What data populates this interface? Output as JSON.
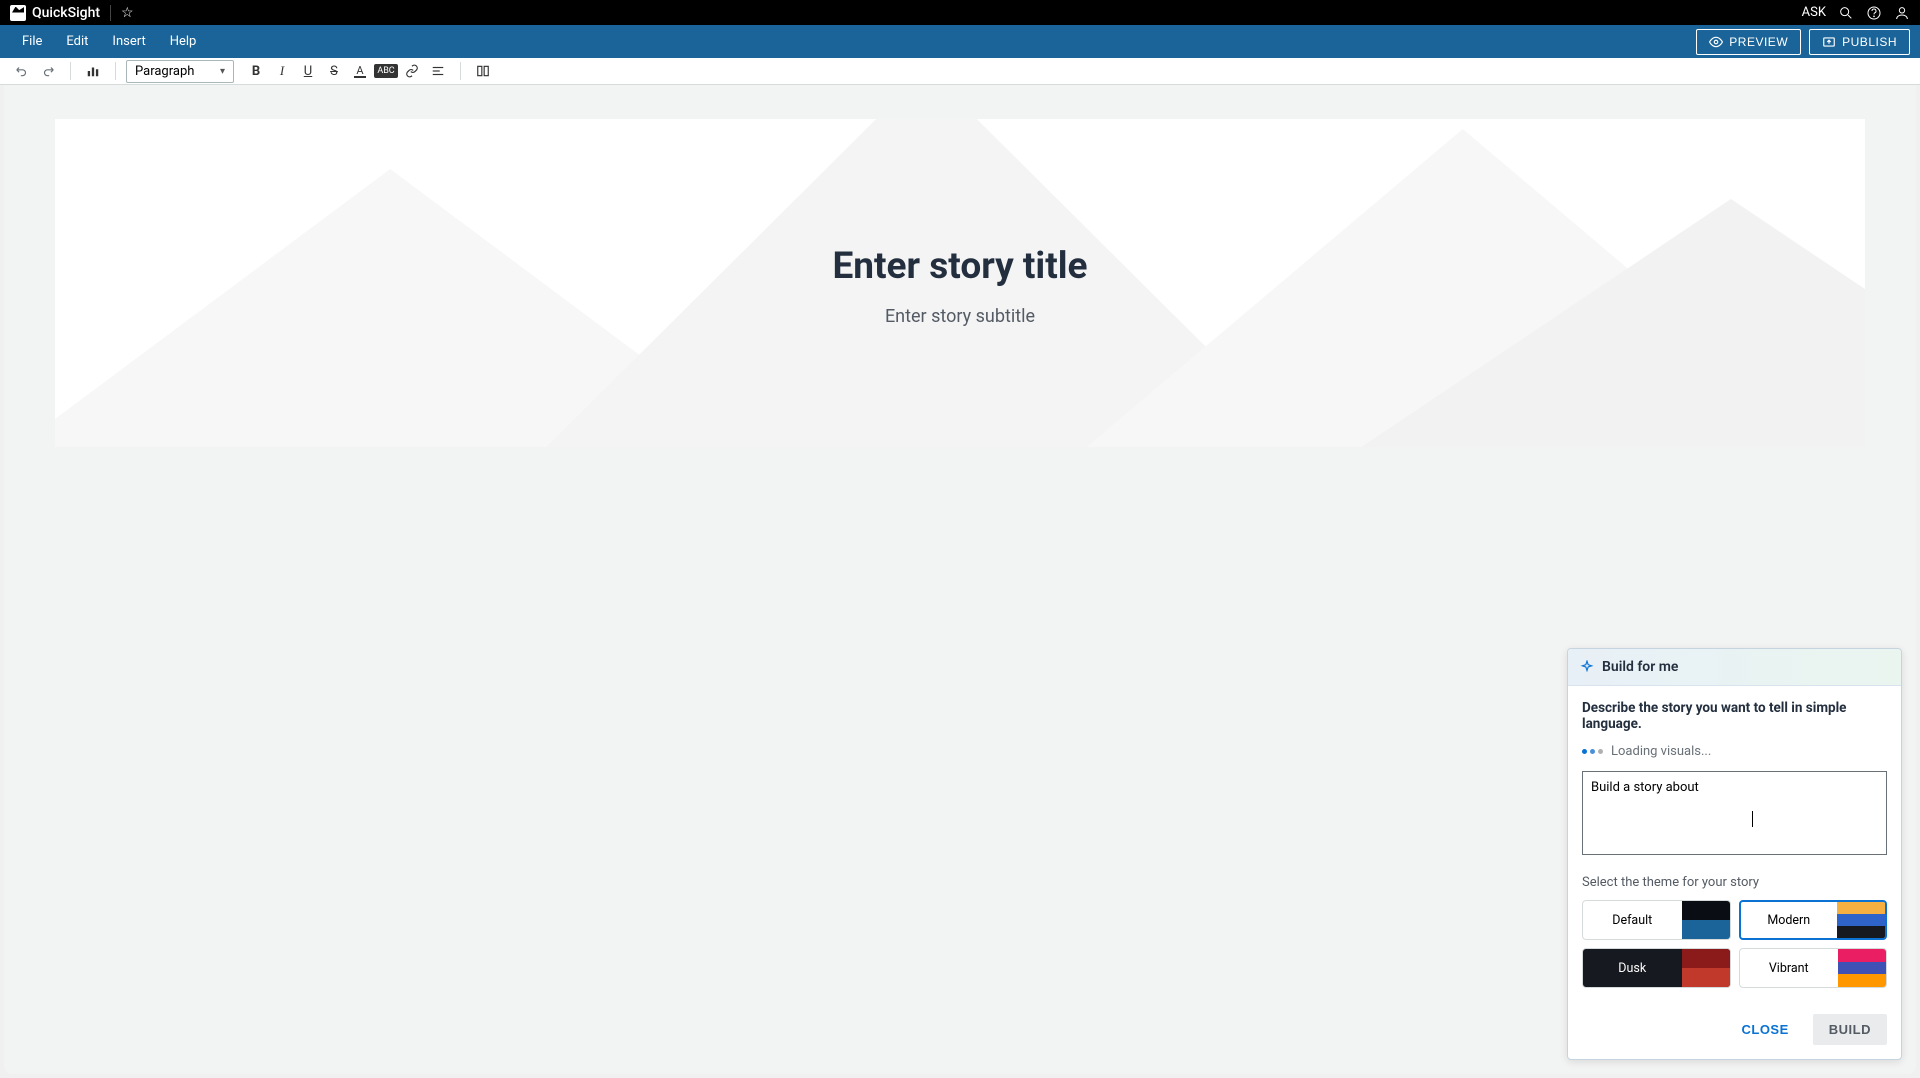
{
  "app": {
    "name": "QuickSight"
  },
  "topbar": {
    "ask": "ASK"
  },
  "menu": {
    "file": "File",
    "edit": "Edit",
    "insert": "Insert",
    "help": "Help",
    "preview": "PREVIEW",
    "publish": "PUBLISH"
  },
  "toolbar": {
    "style": "Paragraph"
  },
  "document": {
    "title_placeholder": "Enter story title",
    "subtitle_placeholder": "Enter story subtitle"
  },
  "panel": {
    "title": "Build for me",
    "description": "Describe the story you want to tell in simple language.",
    "loading": "Loading visuals...",
    "prompt_value": "Build a story about",
    "theme_label": "Select the theme for your story",
    "themes": {
      "default": "Default",
      "modern": "Modern",
      "dusk": "Dusk",
      "vibrant": "Vibrant"
    },
    "close": "CLOSE",
    "build": "BUILD",
    "selected_theme": "Modern"
  },
  "colors": {
    "accent": "#1a6499",
    "primary": "#0972d3"
  }
}
